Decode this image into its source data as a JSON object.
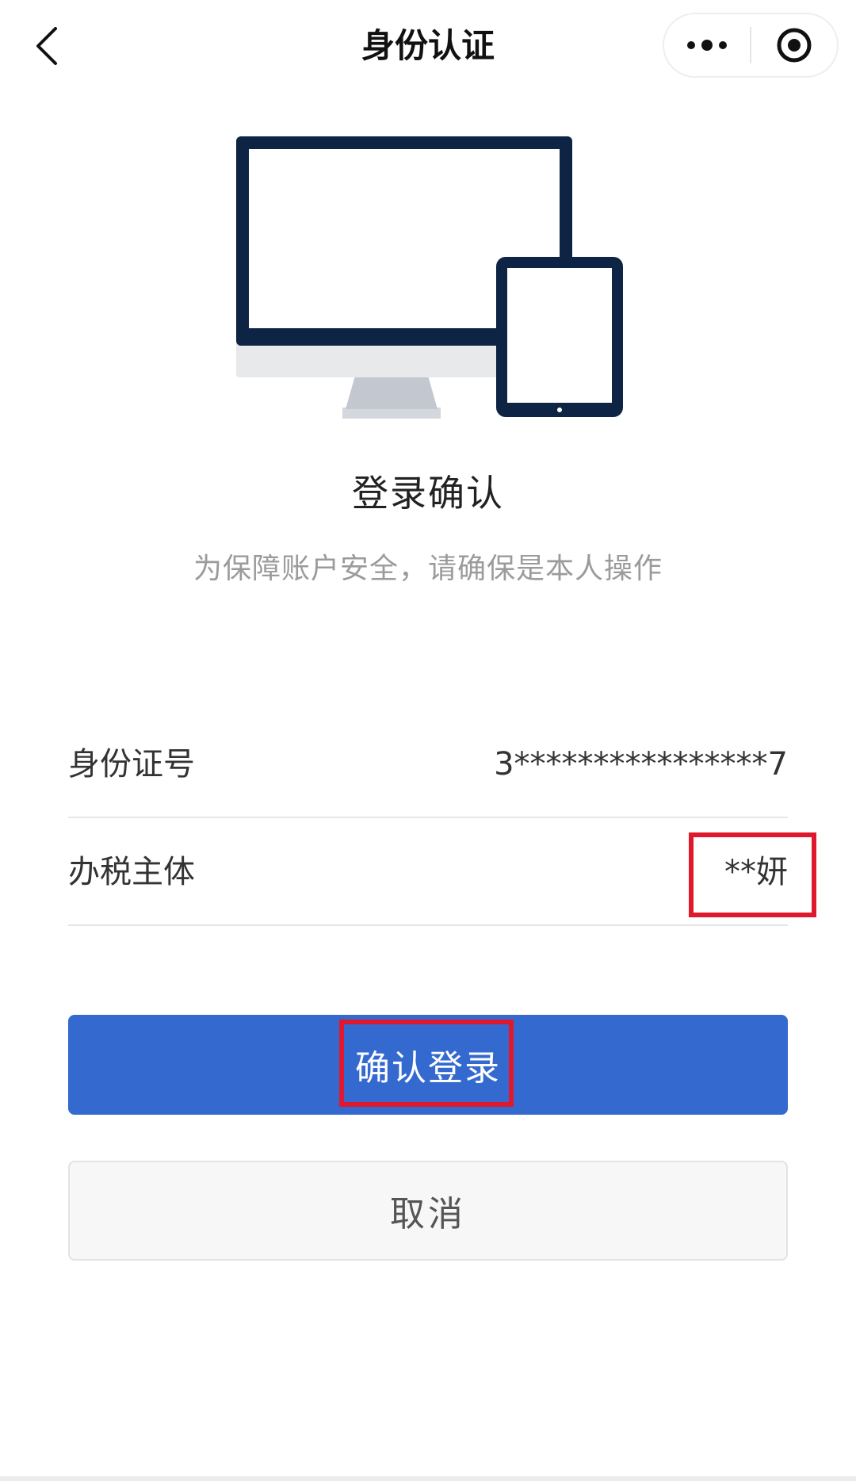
{
  "navbar": {
    "title": "身份认证",
    "back_icon": "chevron-left-icon",
    "more_icon": "more-dots-icon",
    "close_icon": "target-circle-icon"
  },
  "illustration": {
    "name": "monitor-tablet-illustration",
    "colors": {
      "frame": "#0e2444",
      "screen": "#ffffff",
      "bezel": "#e8e9eb",
      "stand": "#c3c8d0"
    }
  },
  "main": {
    "heading": "登录确认",
    "subheading": "为保障账户安全，请确保是本人操作"
  },
  "info": {
    "rows": [
      {
        "label": "身份证号",
        "value": "3****************7"
      },
      {
        "label": "办税主体",
        "value": "**妍"
      }
    ]
  },
  "actions": {
    "confirm_label": "确认登录",
    "cancel_label": "取消"
  },
  "colors": {
    "primary": "#3469cf",
    "highlight": "#e0182d",
    "cancel_bg": "#f7f7f7"
  }
}
